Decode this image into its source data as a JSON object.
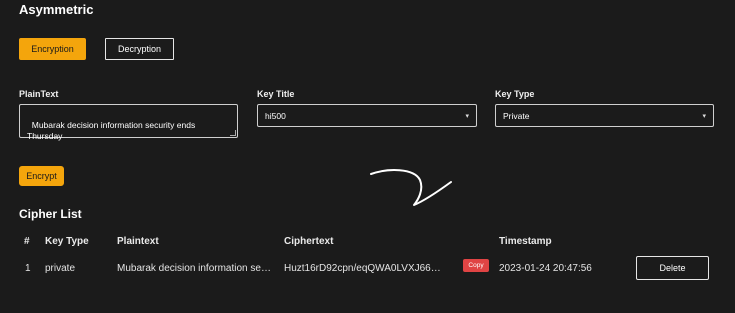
{
  "page": {
    "title": "Asymmetric",
    "tabs": {
      "encryption": "Encryption",
      "decryption": "Decryption"
    }
  },
  "form": {
    "plaintext": {
      "label": "PlainText",
      "value": "Mubarak decision information security ends Thursday"
    },
    "key_title": {
      "label": "Key Title",
      "selected": "hi500"
    },
    "key_type": {
      "label": "Key Type",
      "selected": "Private"
    },
    "encrypt_label": "Encrypt"
  },
  "cipher_list": {
    "title": "Cipher List",
    "headers": {
      "index": "#",
      "key_type": "Key Type",
      "plaintext": "Plaintext",
      "ciphertext": "Ciphertext",
      "timestamp": "Timestamp"
    },
    "rows": [
      {
        "index": "1",
        "key_type": "private",
        "plaintext": "Mubarak decision information se…",
        "ciphertext": "Huzt16rD92cpn/eqQWA0LVXJ66…",
        "copy_label": "Copy",
        "timestamp": "2023-01-24 20:47:56",
        "delete_label": "Delete"
      }
    ]
  },
  "icons": {
    "dropdown": "chevron-down-icon",
    "resize": "resize-grip-icon"
  },
  "colors": {
    "accent": "#f4a50c",
    "background": "#1b1b1b",
    "copy": "#e04444"
  }
}
